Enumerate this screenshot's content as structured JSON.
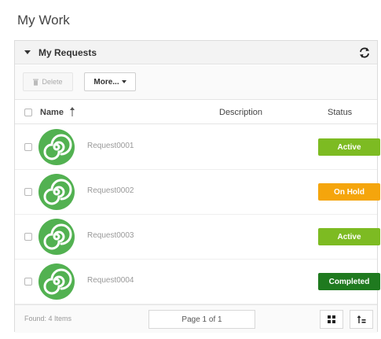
{
  "page": {
    "title": "My Work"
  },
  "panel": {
    "title": "My Requests"
  },
  "toolbar": {
    "delete_label": "Delete",
    "more_label": "More..."
  },
  "table": {
    "columns": {
      "name": "Name",
      "description": "Description",
      "status": "Status"
    },
    "rows": [
      {
        "name": "Request0001",
        "status": "Active",
        "status_color": "#7dbb22"
      },
      {
        "name": "Request0002",
        "status": "On Hold",
        "status_color": "#f5a50c"
      },
      {
        "name": "Request0003",
        "status": "Active",
        "status_color": "#7dbb22"
      },
      {
        "name": "Request0004",
        "status": "Completed",
        "status_color": "#1f7a1f"
      }
    ]
  },
  "footer": {
    "found_text": "Found: 4 Items",
    "page_text": "Page 1 of 1"
  },
  "icons": {
    "avatar": "swirl-icon",
    "refresh": "refresh-icon",
    "sort": "sort-ascending-icon",
    "grid_view": "grid-view-icon",
    "sort_view": "sort-view-icon"
  }
}
